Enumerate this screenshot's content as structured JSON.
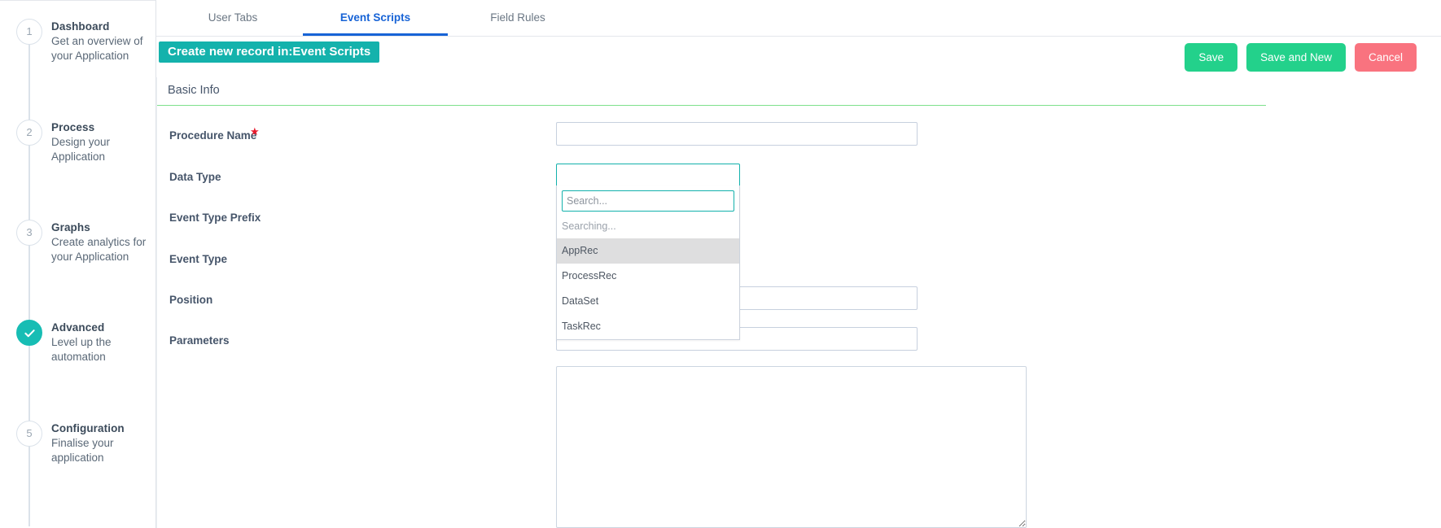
{
  "sidebar": {
    "steps": [
      {
        "number": "1",
        "title": "Dashboard",
        "desc": "Get an overview of your Application",
        "state": "pending"
      },
      {
        "number": "2",
        "title": "Process",
        "desc": "Design your Application",
        "state": "pending"
      },
      {
        "number": "3",
        "title": "Graphs",
        "desc": "Create analytics for your Application",
        "state": "pending"
      },
      {
        "number": "",
        "title": "Advanced",
        "desc": "Level up the automation",
        "state": "done"
      },
      {
        "number": "5",
        "title": "Configuration",
        "desc": "Finalise your application",
        "state": "pending"
      }
    ]
  },
  "tabs": [
    {
      "label": "User Tabs",
      "active": false
    },
    {
      "label": "Event Scripts",
      "active": true
    },
    {
      "label": "Field Rules",
      "active": false
    }
  ],
  "header": {
    "record_badge": "Create new record in:Event Scripts",
    "buttons": {
      "save": "Save",
      "save_and_new": "Save and New",
      "cancel": "Cancel"
    }
  },
  "form": {
    "section_title": "Basic Info",
    "rows": [
      {
        "label": "Procedure Name",
        "required": true,
        "value": ""
      },
      {
        "label": "Data Type",
        "required": false,
        "value": ""
      },
      {
        "label": "Event Type Prefix",
        "required": false,
        "value": ""
      },
      {
        "label": "Event Type",
        "required": false,
        "value": ""
      },
      {
        "label": "Position",
        "required": false,
        "value": ""
      },
      {
        "label": "Parameters",
        "required": false,
        "value": ""
      }
    ],
    "script_body": ""
  },
  "dropdown": {
    "search_placeholder": "Search...",
    "search_value": "",
    "status": "Searching...",
    "options": [
      {
        "label": "AppRec",
        "highlighted": true
      },
      {
        "label": "ProcessRec",
        "highlighted": false
      },
      {
        "label": "DataSet",
        "highlighted": false
      },
      {
        "label": "TaskRec",
        "highlighted": false
      }
    ]
  },
  "colors": {
    "accent_teal": "#14b2ac",
    "tab_active_blue": "#1763d6",
    "button_green": "#23d18b",
    "button_red": "#f9737f",
    "required_star": "#e8192c",
    "section_underline": "#7ee08b"
  }
}
